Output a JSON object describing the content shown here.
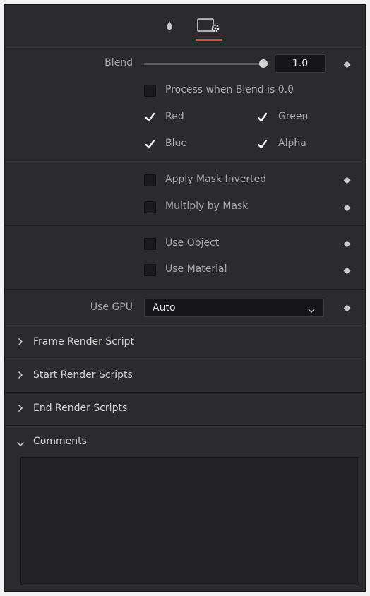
{
  "tabs": [
    {
      "icon": "droplet-icon"
    },
    {
      "icon": "settings-node-icon",
      "active": true
    }
  ],
  "blend": {
    "label": "Blend",
    "value": "1.0",
    "slider_fraction": 1.0
  },
  "process_when_blend": {
    "label": "Process when Blend is 0.0",
    "checked": false
  },
  "channels": {
    "red": {
      "label": "Red",
      "checked": true
    },
    "green": {
      "label": "Green",
      "checked": true
    },
    "blue": {
      "label": "Blue",
      "checked": true
    },
    "alpha": {
      "label": "Alpha",
      "checked": true
    }
  },
  "mask": {
    "apply_inverted": {
      "label": "Apply Mask Inverted",
      "checked": false
    },
    "multiply": {
      "label": "Multiply by Mask",
      "checked": false
    }
  },
  "object": {
    "use_object": {
      "label": "Use Object",
      "checked": false
    },
    "use_material": {
      "label": "Use Material",
      "checked": false
    }
  },
  "gpu": {
    "label": "Use GPU",
    "value": "Auto"
  },
  "sections": [
    {
      "title": "Frame Render Script",
      "expanded": false
    },
    {
      "title": "Start Render Scripts",
      "expanded": false
    },
    {
      "title": "End Render Scripts",
      "expanded": false
    },
    {
      "title": "Comments",
      "expanded": true
    }
  ],
  "comments": {
    "text": ""
  },
  "colors": {
    "accent": "#e8414a",
    "panel": "#2b2b2e"
  }
}
